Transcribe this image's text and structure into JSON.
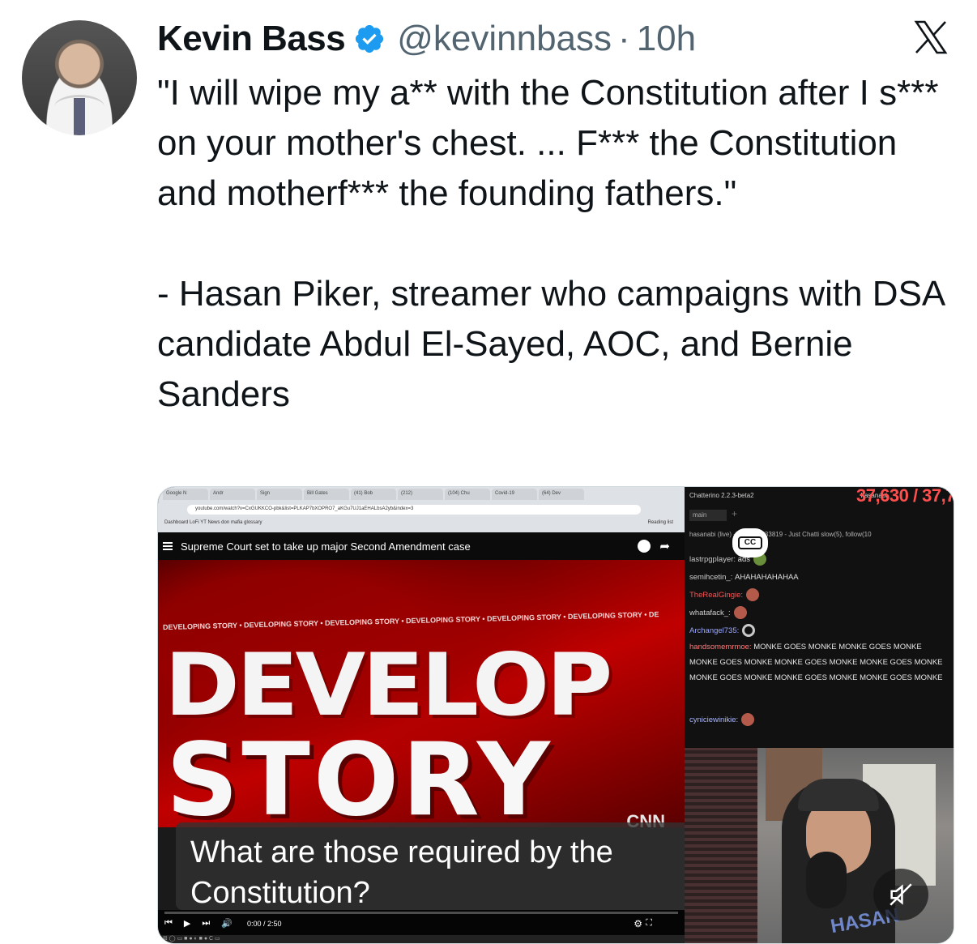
{
  "tweet": {
    "author_name": "Kevin Bass",
    "handle": "@kevinnbass",
    "separator": "·",
    "time": "10h",
    "text": "\"I will wipe my a** with the Constitution after I s*** on your mother's chest. ... F*** the Constitution and motherf*** the founding fathers.\"\n\n- Hasan Piker, streamer who campaigns with DSA candidate Abdul El-Sayed, AOC, and Bernie Sanders",
    "icons": {
      "verified": "verified-badge-icon",
      "platform": "x-logo-icon"
    },
    "colors": {
      "verified": "#1d9bf0",
      "handle": "#536471",
      "text": "#0f1419"
    }
  },
  "media": {
    "browser": {
      "tabs": [
        "Google N",
        "Andr",
        "Sign",
        "Bill Gates",
        "(41) Bob",
        "(212)",
        "(104) Chu",
        "Covid-19",
        "(64) Dev"
      ],
      "url": "youtube.com/watch?v=CxGUKKCO-pbk&list=PLKAP7bXOPRO7_aKGu7UJ1aEHALbsA2yb&index=3",
      "bookmarks": "Dashboard   LoFi   YT   News   don   mafia glossary",
      "reading_list": "Reading list"
    },
    "video_title": "Supreme Court set to take up major Second Amendment case",
    "news_ticker": "DEVELOPING STORY • DEVELOPING STORY • DEVELOPING STORY • DEVELOPING STORY • DEVELOPING STORY • DEVELOPING STORY • DE",
    "news_big1": "DEVELOP",
    "news_big2": "STORY",
    "network_logo": "CNN",
    "caption": "What are those required by the Constitution?",
    "player_time": "0:00 / 2:50",
    "chat": {
      "app_title": "Chatterino 2.2.3-beta2",
      "channel": "hasanabi",
      "viewers": "37,630 / 37,7",
      "tab": "main",
      "status": "hasanabi (live) - 2h 12m - 33819 - Just Chatti   slow(5), follow(10",
      "messages": [
        {
          "user": "lastrpgplayer:",
          "text": "ads"
        },
        {
          "user": "semihcetin_:",
          "text": "AHAHAHAHAHAA"
        },
        {
          "user": "TheRealGingie:",
          "text": ""
        },
        {
          "user": "whatafack_:",
          "text": ""
        },
        {
          "user": "Archangel735:",
          "text": ""
        },
        {
          "user": "handsomemrmoe:",
          "text": "MONKE GOES MONKE  MONKE GOES MONKE  MONKE GOES MONKE  MONKE GOES MONKE  MONKE GOES MONKE  MONKE GOES MONKE  MONKE GOES MONKE  MONKE GOES MONKE"
        },
        {
          "user": "cyniciewinikie:",
          "text": ""
        }
      ],
      "cc_label": "CC"
    },
    "cam_text": "HASAN"
  }
}
